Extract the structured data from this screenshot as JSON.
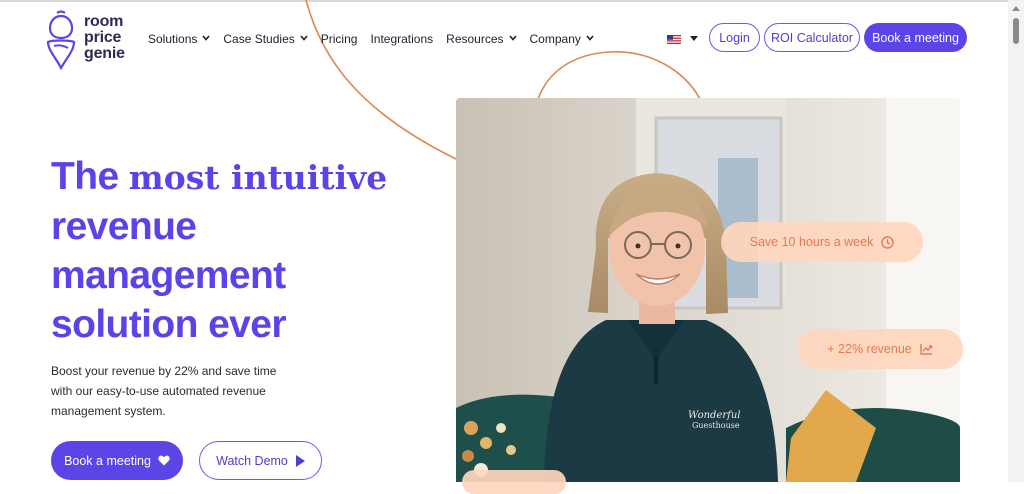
{
  "brand": {
    "line1": "room",
    "line2": "price",
    "line3": "genie"
  },
  "nav": {
    "items": [
      {
        "label": "Solutions",
        "has_dropdown": true
      },
      {
        "label": "Case Studies",
        "has_dropdown": true
      },
      {
        "label": "Pricing",
        "has_dropdown": false
      },
      {
        "label": "Integrations",
        "has_dropdown": false
      },
      {
        "label": "Resources",
        "has_dropdown": true
      },
      {
        "label": "Company",
        "has_dropdown": true
      }
    ],
    "language_icon": "us-flag-icon",
    "login": "Login",
    "roi": "ROI Calculator",
    "book": "Book a meeting"
  },
  "hero": {
    "headline_1a": "The",
    "headline_1b": "most intuitive",
    "headline_2": "revenue",
    "headline_3": "management",
    "headline_4": "solution ever",
    "subtext": "Boost your revenue by 22% and save time with our easy-to-use automated revenue management system.",
    "cta_book": "Book a meeting",
    "cta_demo": "Watch Demo"
  },
  "badges": {
    "save": "Save 10 hours a week",
    "revenue": "+ 22% revenue"
  },
  "colors": {
    "brand_purple": "#5b45e6",
    "accent_orange": "#e0864f",
    "badge_bg": "#ffd6be",
    "badge_text": "#e07c52"
  }
}
